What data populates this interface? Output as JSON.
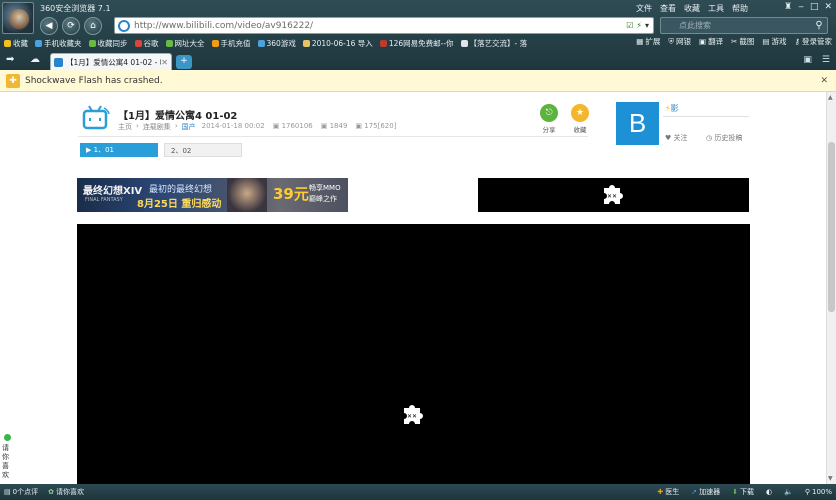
{
  "app": {
    "title": "360安全浏览器 7.1"
  },
  "menu": [
    "文件",
    "查看",
    "收藏",
    "工具",
    "帮助"
  ],
  "address": {
    "url": "http://www.bilibili.com/video/av916222/"
  },
  "search": {
    "placeholder": "点此搜索"
  },
  "bookmarks": [
    {
      "label": "收藏",
      "color": "#f3c21c"
    },
    {
      "label": "手机收藏夹",
      "color": "#4aa3df"
    },
    {
      "label": "收藏同步",
      "color": "#69b947"
    },
    {
      "label": "谷歌",
      "color": "#d34836"
    },
    {
      "label": "网址大全",
      "color": "#69b947"
    },
    {
      "label": "手机充值",
      "color": "#f39c12"
    },
    {
      "label": "360游戏",
      "color": "#4aa3df"
    },
    {
      "label": "2010-06-16 导入",
      "color": "#e6c26a"
    },
    {
      "label": "126网易免费邮--你",
      "color": "#c0392b"
    },
    {
      "label": "【落艺交流】- 落",
      "color": "#dfe6e9"
    }
  ],
  "bookmarks_right": [
    "扩展",
    "网银",
    "翻译",
    "截图",
    "游戏",
    "登录管家"
  ],
  "tab": {
    "label": "【1月】爱情公寓4 01-02 - 哔"
  },
  "infobar": {
    "text": "Shockwave Flash has crashed."
  },
  "video": {
    "title": "【1月】爱情公寓4  01-02",
    "crumbs": [
      "主页",
      "连载剧集",
      "国产"
    ],
    "date": "2014-01-18 00:02",
    "stats": [
      "1760106",
      "1849",
      "175[620]"
    ],
    "share_label": "分享",
    "fav_label": "收藏",
    "parts": [
      "1、01",
      "2、02"
    ]
  },
  "uploader": {
    "avatar_letter": "B",
    "name": "影",
    "follow_label": "关注",
    "history_label": "历史投稿"
  },
  "banner": {
    "title": "最终幻想XIV",
    "subtitle": "FINAL FANTASY",
    "slogan": "最初的最终幻想",
    "date_text": "8月25日 重归感动",
    "price": "39元",
    "tag1": "畅享MMO",
    "tag2": "巅峰之作"
  },
  "feedback": {
    "label": "请你喜欢"
  },
  "status": {
    "left": [
      "0个点评",
      "请你喜欢"
    ],
    "right": [
      "医生",
      "加速器",
      "下载",
      "100%"
    ]
  }
}
